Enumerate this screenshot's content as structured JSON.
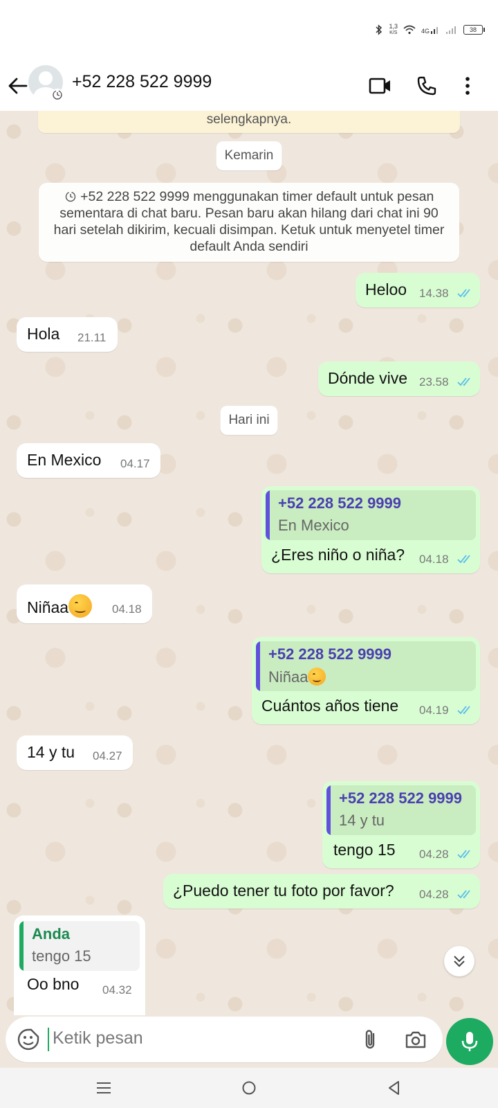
{
  "status_bar": {
    "speed_value": "1,3",
    "speed_unit": "K/S",
    "network": "4G",
    "battery": "38"
  },
  "header": {
    "contact_name": "+52 228 522 9999"
  },
  "chat": {
    "banner_text": "selengkapnya.",
    "date_yesterday": "Kemarin",
    "system_message": "+52 228 522 9999 menggunakan timer default untuk pesan sementara di chat baru. Pesan baru akan hilang dari chat ini 90 hari setelah dikirim, kecuali disimpan. Ketuk untuk menyetel timer default Anda sendiri",
    "date_today": "Hari ini",
    "messages": [
      {
        "direction": "out",
        "text": "Heloo",
        "time": "14.38"
      },
      {
        "direction": "in",
        "text": "Hola",
        "time": "21.11"
      },
      {
        "direction": "out",
        "text": "Dónde vive",
        "time": "23.58"
      },
      {
        "direction": "in",
        "text": "En Mexico",
        "time": "04.17"
      },
      {
        "direction": "out",
        "quote_name": "+52 228 522 9999",
        "quote_text": "En Mexico",
        "text": "¿Eres niño o niña?",
        "time": "04.18"
      },
      {
        "direction": "in",
        "text": "Niñaa",
        "time": "04.18"
      },
      {
        "direction": "out",
        "quote_name": "+52 228 522 9999",
        "quote_text": "Niñaa",
        "text": "Cuántos años tiene",
        "time": "04.19"
      },
      {
        "direction": "in",
        "text": "14 y tu",
        "time": "04.27"
      },
      {
        "direction": "out",
        "quote_name": "+52 228 522 9999",
        "quote_text": "14 y tu",
        "text": "tengo 15",
        "time": "04.28"
      },
      {
        "direction": "out",
        "text": "¿Puedo tener tu foto por favor?",
        "time": "04.28"
      },
      {
        "direction": "in",
        "quote_name": "Anda",
        "quote_text": "tengo 15",
        "text": "Oo bno",
        "time": "04.32"
      }
    ]
  },
  "composer": {
    "placeholder": "Ketik pesan"
  },
  "colors": {
    "accent": "#1daa61",
    "outgoing_bubble": "#d9fdd3",
    "incoming_bubble": "#ffffff",
    "tick_read": "#53bdeb",
    "quote_bar_out": "#6050dc",
    "quote_bar_in": "#1daa61",
    "chat_bg": "#efe7dd"
  }
}
